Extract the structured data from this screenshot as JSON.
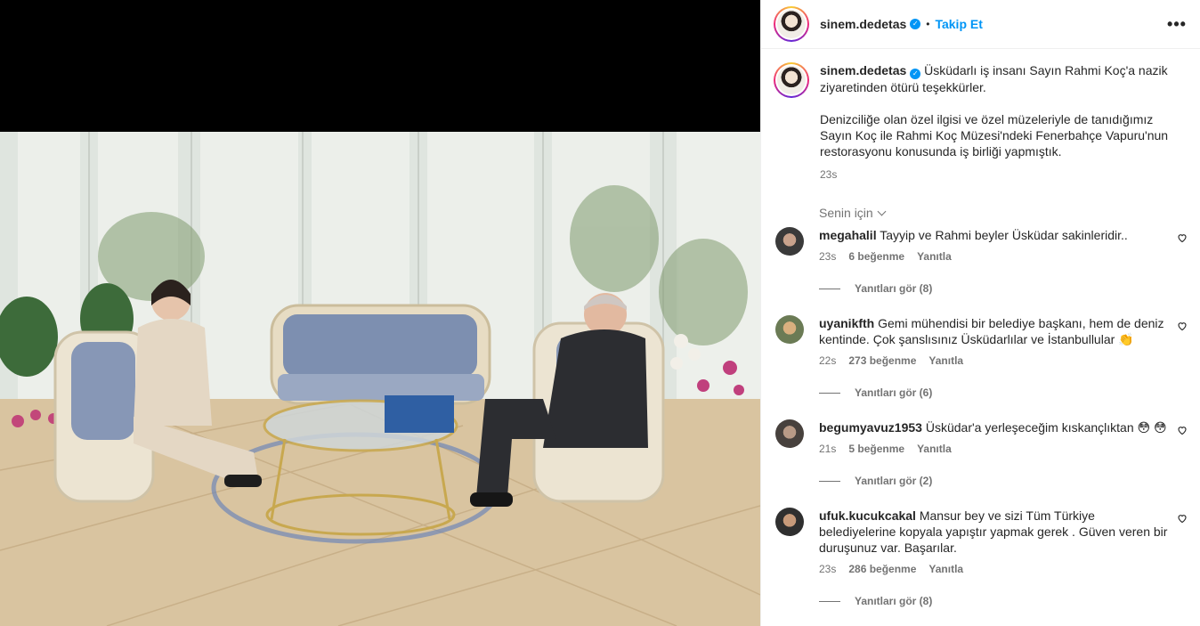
{
  "post": {
    "username": "sinem.dedetas",
    "follow_label": "Takip Et",
    "dot": "•",
    "more_label": "•••",
    "caption_p1": "Üsküdarlı iş insanı Sayın Rahmi Koç'a nazik ziyaretinden ötürü teşekkürler.",
    "caption_p2": "Denizciliğe olan özel ilgisi ve özel müzeleriyle de tanıdığımız Sayın Koç ile Rahmi Koç Müzesi'ndeki Fenerbahçe Vapuru'nun restorasyonu konusunda iş birliği yapmıştık.",
    "time": "23s",
    "for_you": "Senin için"
  },
  "comments": [
    {
      "user": "megahalil",
      "text": "Tayyip ve Rahmi beyler Üsküdar sakinleridir..",
      "time": "23s",
      "likes": "6 beğenme",
      "reply": "Yanıtla",
      "view_replies": "Yanıtları gör (8)"
    },
    {
      "user": "uyanikfth",
      "text": "Gemi mühendisi bir belediye başkanı, hem de deniz kentinde. Çok şanslısınız Üsküdarlılar ve İstanbullular 👏",
      "time": "22s",
      "likes": "273 beğenme",
      "reply": "Yanıtla",
      "view_replies": "Yanıtları gör (6)"
    },
    {
      "user": "begumyavuz1953",
      "text": "Üsküdar'a yerleşeceğim kıskançlıktan 😳 😳",
      "time": "21s",
      "likes": "5 beğenme",
      "reply": "Yanıtla",
      "view_replies": "Yanıtları gör (2)"
    },
    {
      "user": "ufuk.kucukcakal",
      "text": "Mansur bey ve sizi Tüm Türkiye belediyelerine kopyala yapıştır yapmak gerek . Güven veren bir duruşunuz var. Başarılar.",
      "time": "23s",
      "likes": "286 beğenme",
      "reply": "Yanıtla",
      "view_replies": "Yanıtları gör (8)"
    }
  ],
  "icons": {
    "verified": "verified-badge-icon",
    "heart": "heart-outline-icon",
    "chevron": "chevron-down-icon"
  },
  "colors": {
    "link": "#0095f6",
    "muted": "#737373",
    "text": "#262626"
  }
}
